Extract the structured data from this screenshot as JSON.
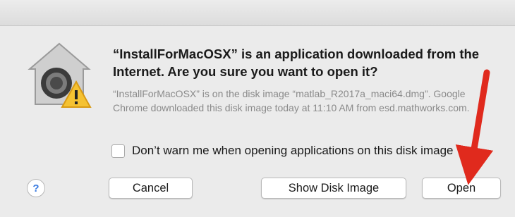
{
  "dialog": {
    "headline": "“InstallForMacOSX” is an application downloaded from the Internet. Are you sure you want to open it?",
    "detail": "“InstallForMacOSX” is on the disk image “matlab_R2017a_maci64.dmg”. Google Chrome downloaded this disk image today at 11:10 AM from esd.mathworks.com.",
    "checkbox_label": "Don’t warn me when opening applications on this disk image",
    "checkbox_checked": false,
    "buttons": {
      "help": "?",
      "cancel": "Cancel",
      "show_disk_image": "Show Disk Image",
      "open": "Open"
    },
    "icon": "gatekeeper-security-icon",
    "arrow_color": "#e02a1d"
  }
}
